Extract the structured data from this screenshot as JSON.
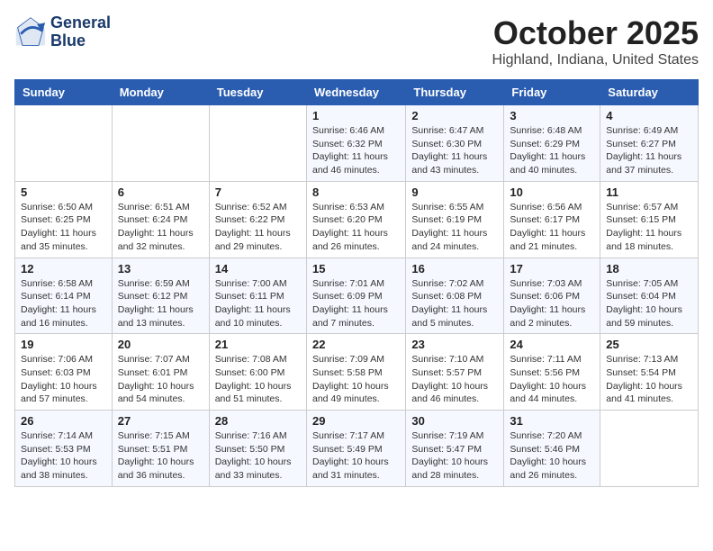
{
  "logo": {
    "line1": "General",
    "line2": "Blue"
  },
  "title": "October 2025",
  "subtitle": "Highland, Indiana, United States",
  "headers": [
    "Sunday",
    "Monday",
    "Tuesday",
    "Wednesday",
    "Thursday",
    "Friday",
    "Saturday"
  ],
  "weeks": [
    [
      {
        "day": "",
        "info": ""
      },
      {
        "day": "",
        "info": ""
      },
      {
        "day": "",
        "info": ""
      },
      {
        "day": "1",
        "info": "Sunrise: 6:46 AM\nSunset: 6:32 PM\nDaylight: 11 hours and 46 minutes."
      },
      {
        "day": "2",
        "info": "Sunrise: 6:47 AM\nSunset: 6:30 PM\nDaylight: 11 hours and 43 minutes."
      },
      {
        "day": "3",
        "info": "Sunrise: 6:48 AM\nSunset: 6:29 PM\nDaylight: 11 hours and 40 minutes."
      },
      {
        "day": "4",
        "info": "Sunrise: 6:49 AM\nSunset: 6:27 PM\nDaylight: 11 hours and 37 minutes."
      }
    ],
    [
      {
        "day": "5",
        "info": "Sunrise: 6:50 AM\nSunset: 6:25 PM\nDaylight: 11 hours and 35 minutes."
      },
      {
        "day": "6",
        "info": "Sunrise: 6:51 AM\nSunset: 6:24 PM\nDaylight: 11 hours and 32 minutes."
      },
      {
        "day": "7",
        "info": "Sunrise: 6:52 AM\nSunset: 6:22 PM\nDaylight: 11 hours and 29 minutes."
      },
      {
        "day": "8",
        "info": "Sunrise: 6:53 AM\nSunset: 6:20 PM\nDaylight: 11 hours and 26 minutes."
      },
      {
        "day": "9",
        "info": "Sunrise: 6:55 AM\nSunset: 6:19 PM\nDaylight: 11 hours and 24 minutes."
      },
      {
        "day": "10",
        "info": "Sunrise: 6:56 AM\nSunset: 6:17 PM\nDaylight: 11 hours and 21 minutes."
      },
      {
        "day": "11",
        "info": "Sunrise: 6:57 AM\nSunset: 6:15 PM\nDaylight: 11 hours and 18 minutes."
      }
    ],
    [
      {
        "day": "12",
        "info": "Sunrise: 6:58 AM\nSunset: 6:14 PM\nDaylight: 11 hours and 16 minutes."
      },
      {
        "day": "13",
        "info": "Sunrise: 6:59 AM\nSunset: 6:12 PM\nDaylight: 11 hours and 13 minutes."
      },
      {
        "day": "14",
        "info": "Sunrise: 7:00 AM\nSunset: 6:11 PM\nDaylight: 11 hours and 10 minutes."
      },
      {
        "day": "15",
        "info": "Sunrise: 7:01 AM\nSunset: 6:09 PM\nDaylight: 11 hours and 7 minutes."
      },
      {
        "day": "16",
        "info": "Sunrise: 7:02 AM\nSunset: 6:08 PM\nDaylight: 11 hours and 5 minutes."
      },
      {
        "day": "17",
        "info": "Sunrise: 7:03 AM\nSunset: 6:06 PM\nDaylight: 11 hours and 2 minutes."
      },
      {
        "day": "18",
        "info": "Sunrise: 7:05 AM\nSunset: 6:04 PM\nDaylight: 10 hours and 59 minutes."
      }
    ],
    [
      {
        "day": "19",
        "info": "Sunrise: 7:06 AM\nSunset: 6:03 PM\nDaylight: 10 hours and 57 minutes."
      },
      {
        "day": "20",
        "info": "Sunrise: 7:07 AM\nSunset: 6:01 PM\nDaylight: 10 hours and 54 minutes."
      },
      {
        "day": "21",
        "info": "Sunrise: 7:08 AM\nSunset: 6:00 PM\nDaylight: 10 hours and 51 minutes."
      },
      {
        "day": "22",
        "info": "Sunrise: 7:09 AM\nSunset: 5:58 PM\nDaylight: 10 hours and 49 minutes."
      },
      {
        "day": "23",
        "info": "Sunrise: 7:10 AM\nSunset: 5:57 PM\nDaylight: 10 hours and 46 minutes."
      },
      {
        "day": "24",
        "info": "Sunrise: 7:11 AM\nSunset: 5:56 PM\nDaylight: 10 hours and 44 minutes."
      },
      {
        "day": "25",
        "info": "Sunrise: 7:13 AM\nSunset: 5:54 PM\nDaylight: 10 hours and 41 minutes."
      }
    ],
    [
      {
        "day": "26",
        "info": "Sunrise: 7:14 AM\nSunset: 5:53 PM\nDaylight: 10 hours and 38 minutes."
      },
      {
        "day": "27",
        "info": "Sunrise: 7:15 AM\nSunset: 5:51 PM\nDaylight: 10 hours and 36 minutes."
      },
      {
        "day": "28",
        "info": "Sunrise: 7:16 AM\nSunset: 5:50 PM\nDaylight: 10 hours and 33 minutes."
      },
      {
        "day": "29",
        "info": "Sunrise: 7:17 AM\nSunset: 5:49 PM\nDaylight: 10 hours and 31 minutes."
      },
      {
        "day": "30",
        "info": "Sunrise: 7:19 AM\nSunset: 5:47 PM\nDaylight: 10 hours and 28 minutes."
      },
      {
        "day": "31",
        "info": "Sunrise: 7:20 AM\nSunset: 5:46 PM\nDaylight: 10 hours and 26 minutes."
      },
      {
        "day": "",
        "info": ""
      }
    ]
  ]
}
